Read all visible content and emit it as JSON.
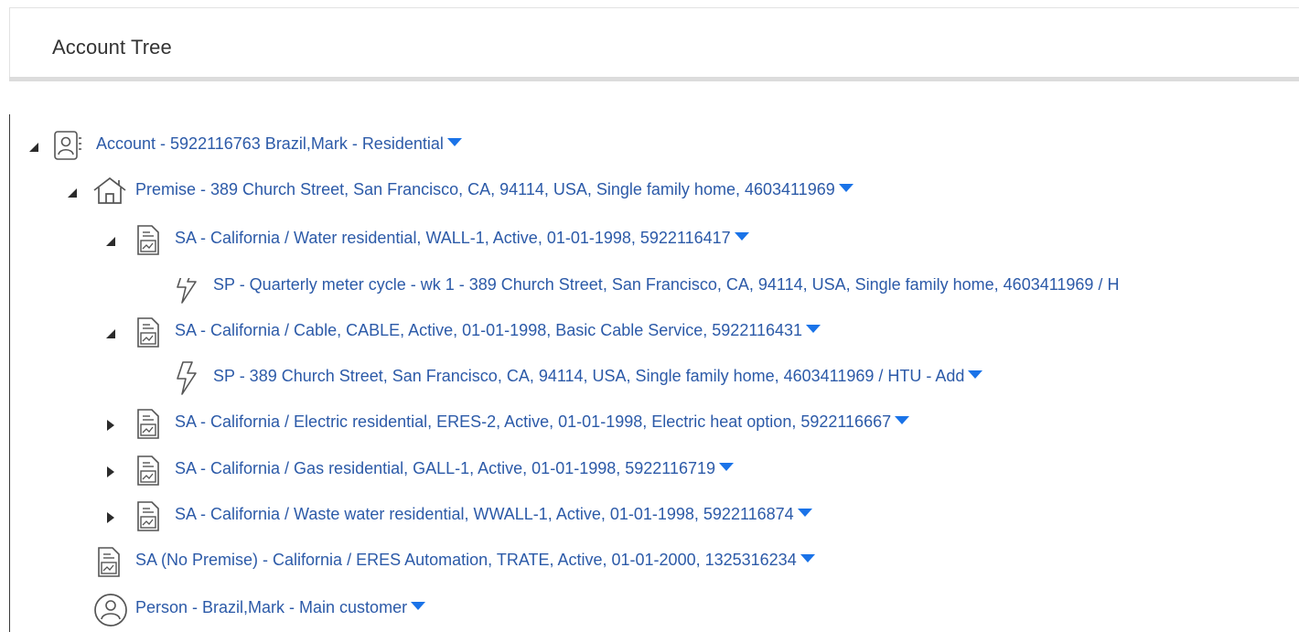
{
  "panel": {
    "title": "Account Tree"
  },
  "colors": {
    "link": "#2c5aa8",
    "caret": "#1a73e8",
    "icon_stroke": "#555555"
  },
  "tree": {
    "account": {
      "label": "Account - 5922116763 Brazil,Mark - Residential",
      "icon": "account-card-icon",
      "expanded": true
    },
    "premise": {
      "label": "Premise - 389 Church Street, San Francisco, CA, 94114, USA, Single family home, 4603411969",
      "icon": "house-icon",
      "expanded": true
    },
    "sa_water": {
      "label": "SA - California / Water residential, WALL-1, Active, 01-01-1998, 5922116417",
      "icon": "document-icon",
      "expanded": true
    },
    "sp_water": {
      "label": "SP - Quarterly meter cycle - wk 1 - 389 Church Street, San Francisco, CA, 94114, USA, Single family home, 4603411969 / H",
      "icon": "lightning-icon"
    },
    "sa_cable": {
      "label": "SA - California / Cable, CABLE, Active, 01-01-1998, Basic Cable Service, 5922116431",
      "icon": "document-icon",
      "expanded": true
    },
    "sp_cable": {
      "label": "SP - 389 Church Street, San Francisco, CA, 94114, USA, Single family home, 4603411969 / HTU - Add",
      "icon": "lightning-icon"
    },
    "sa_electric": {
      "label": "SA - California / Electric residential, ERES-2, Active, 01-01-1998, Electric heat option, 5922116667",
      "icon": "document-icon",
      "expanded": false
    },
    "sa_gas": {
      "label": "SA - California / Gas residential, GALL-1, Active, 01-01-1998, 5922116719",
      "icon": "document-icon",
      "expanded": false
    },
    "sa_wastewater": {
      "label": "SA - California / Waste water residential, WWALL-1, Active, 01-01-1998, 5922116874",
      "icon": "document-icon",
      "expanded": false
    },
    "sa_no_premise": {
      "label": "SA (No Premise) - California / ERES Automation, TRATE, Active, 01-01-2000, 1325316234",
      "icon": "document-icon"
    },
    "person": {
      "label": "Person - Brazil,Mark - Main customer",
      "icon": "person-circle-icon"
    }
  }
}
